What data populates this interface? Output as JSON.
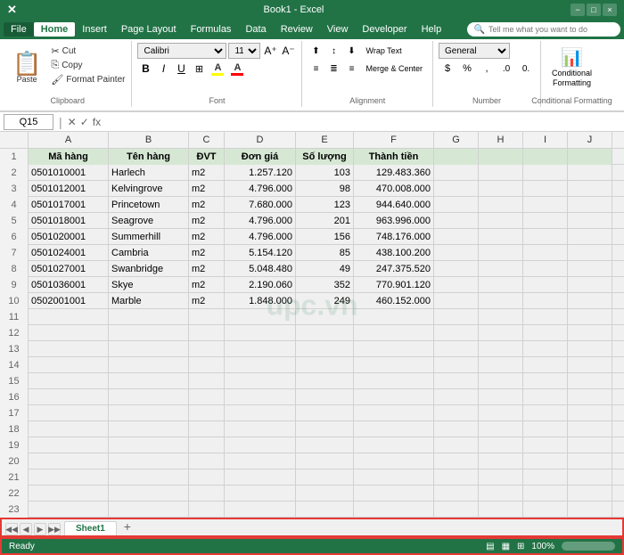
{
  "titleBar": {
    "fileName": "Book1 - Excel",
    "winControls": [
      "−",
      "□",
      "×"
    ]
  },
  "menuBar": {
    "items": [
      "File",
      "Home",
      "Insert",
      "Page Layout",
      "Formulas",
      "Data",
      "Review",
      "View",
      "Developer",
      "Help"
    ],
    "activeItem": "Home",
    "searchPlaceholder": "Tell me what you want to do"
  },
  "ribbon": {
    "clipboard": {
      "label": "Clipboard",
      "paste": "Paste",
      "cut": "✂ Cut",
      "copy": "⎘ Copy",
      "formatPainter": "🖌 Format Painter"
    },
    "font": {
      "label": "Font",
      "fontName": "Calibri",
      "fontSize": "11",
      "bold": "B",
      "italic": "I",
      "underline": "U",
      "border": "⊞",
      "fillColor": "A",
      "fontColor": "A"
    },
    "alignment": {
      "label": "Alignment",
      "wrapText": "Wrap Text",
      "mergeCenter": "Merge & Center"
    },
    "number": {
      "label": "Number",
      "format": "General"
    },
    "conditionalFormatting": {
      "label": "Conditional\nFormatting"
    }
  },
  "formulaBar": {
    "cellRef": "Q15",
    "formula": ""
  },
  "spreadsheet": {
    "columns": [
      "A",
      "B",
      "C",
      "D",
      "E",
      "F",
      "G",
      "H",
      "I",
      "J"
    ],
    "headers": [
      "Mã hàng",
      "Tên hàng",
      "ĐVT",
      "Đơn giá",
      "Số lượng",
      "Thành tiền",
      "",
      "",
      "",
      ""
    ],
    "rows": [
      {
        "num": 1,
        "cells": [
          "Mã hàng",
          "Tên hàng",
          "ĐVT",
          "Đơn giá",
          "Số lượng",
          "Thành tiền",
          "",
          "",
          "",
          ""
        ]
      },
      {
        "num": 2,
        "cells": [
          "0501010001",
          "Harlech",
          "m2",
          "1.257.120",
          "103",
          "129.483.360",
          "",
          "",
          "",
          ""
        ]
      },
      {
        "num": 3,
        "cells": [
          "0501012001",
          "Kelvingrove",
          "m2",
          "4.796.000",
          "98",
          "470.008.000",
          "",
          "",
          "",
          ""
        ]
      },
      {
        "num": 4,
        "cells": [
          "0501017001",
          "Princetown",
          "m2",
          "7.680.000",
          "123",
          "944.640.000",
          "",
          "",
          "",
          ""
        ]
      },
      {
        "num": 5,
        "cells": [
          "0501018001",
          "Seagrove",
          "m2",
          "4.796.000",
          "201",
          "963.996.000",
          "",
          "",
          "",
          ""
        ]
      },
      {
        "num": 6,
        "cells": [
          "0501020001",
          "Summerhill",
          "m2",
          "4.796.000",
          "156",
          "748.176.000",
          "",
          "",
          "",
          ""
        ]
      },
      {
        "num": 7,
        "cells": [
          "0501024001",
          "Cambria",
          "m2",
          "5.154.120",
          "85",
          "438.100.200",
          "",
          "",
          "",
          ""
        ]
      },
      {
        "num": 8,
        "cells": [
          "0501027001",
          "Swanbridge",
          "m2",
          "5.048.480",
          "49",
          "247.375.520",
          "",
          "",
          "",
          ""
        ]
      },
      {
        "num": 9,
        "cells": [
          "0501036001",
          "Skye",
          "m2",
          "2.190.060",
          "352",
          "770.901.120",
          "",
          "",
          "",
          ""
        ]
      },
      {
        "num": 10,
        "cells": [
          "0502001001",
          "Marble",
          "m2",
          "1.848.000",
          "249",
          "460.152.000",
          "",
          "",
          "",
          ""
        ]
      },
      {
        "num": 11,
        "cells": [
          "",
          "",
          "",
          "",
          "",
          "",
          "",
          "",
          "",
          ""
        ]
      },
      {
        "num": 12,
        "cells": [
          "",
          "",
          "",
          "",
          "",
          "",
          "",
          "",
          "",
          ""
        ]
      },
      {
        "num": 13,
        "cells": [
          "",
          "",
          "",
          "",
          "",
          "",
          "",
          "",
          "",
          ""
        ]
      },
      {
        "num": 14,
        "cells": [
          "",
          "",
          "",
          "",
          "",
          "",
          "",
          "",
          "",
          ""
        ]
      },
      {
        "num": 15,
        "cells": [
          "",
          "",
          "",
          "",
          "",
          "",
          "",
          "",
          "",
          ""
        ]
      },
      {
        "num": 16,
        "cells": [
          "",
          "",
          "",
          "",
          "",
          "",
          "",
          "",
          "",
          ""
        ]
      },
      {
        "num": 17,
        "cells": [
          "",
          "",
          "",
          "",
          "",
          "",
          "",
          "",
          "",
          ""
        ]
      },
      {
        "num": 18,
        "cells": [
          "",
          "",
          "",
          "",
          "",
          "",
          "",
          "",
          "",
          ""
        ]
      },
      {
        "num": 19,
        "cells": [
          "",
          "",
          "",
          "",
          "",
          "",
          "",
          "",
          "",
          ""
        ]
      },
      {
        "num": 20,
        "cells": [
          "",
          "",
          "",
          "",
          "",
          "",
          "",
          "",
          "",
          ""
        ]
      },
      {
        "num": 21,
        "cells": [
          "",
          "",
          "",
          "",
          "",
          "",
          "",
          "",
          "",
          ""
        ]
      },
      {
        "num": 22,
        "cells": [
          "",
          "",
          "",
          "",
          "",
          "",
          "",
          "",
          "",
          ""
        ]
      },
      {
        "num": 23,
        "cells": [
          "",
          "",
          "",
          "",
          "",
          "",
          "",
          "",
          "",
          ""
        ]
      }
    ],
    "selectedCell": "Q15",
    "sheetTabs": [
      "Sheet1"
    ],
    "activeSheet": "Sheet1"
  },
  "statusBar": {
    "items": [
      "Ready"
    ],
    "rightItems": [
      "",
      "100%"
    ]
  },
  "watermarkText": "upc.vn"
}
